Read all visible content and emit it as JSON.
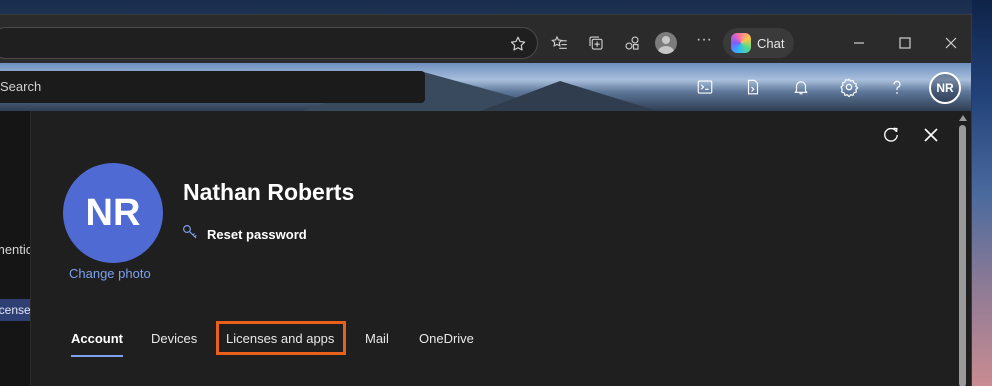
{
  "browser": {
    "chat_label": "Chat",
    "icons": [
      "favorite-star-icon",
      "favorites-icon",
      "collections-icon",
      "extensions-icon",
      "profile-icon",
      "more-icon",
      "copilot-icon",
      "minimize-icon",
      "maximize-icon",
      "close-icon"
    ]
  },
  "admin_header": {
    "search_placeholder": "Search",
    "icons": [
      "terminal-icon",
      "document-icon",
      "bell-icon",
      "gear-icon",
      "help-icon"
    ],
    "avatar_initials": "NR"
  },
  "left_nav": {
    "partial_item": "mentic",
    "partial_selected": "icense"
  },
  "user_panel": {
    "avatar_initials": "NR",
    "avatar_color": "#4f6bd3",
    "change_photo": "Change photo",
    "name": "Nathan Roberts",
    "reset_password": "Reset password",
    "tabs": [
      {
        "label": "Account",
        "active": true
      },
      {
        "label": "Devices",
        "active": false
      },
      {
        "label": "Licenses and apps",
        "active": false,
        "highlighted": true
      },
      {
        "label": "Mail",
        "active": false
      },
      {
        "label": "OneDrive",
        "active": false
      }
    ],
    "highlight_color": "#e8601c"
  }
}
